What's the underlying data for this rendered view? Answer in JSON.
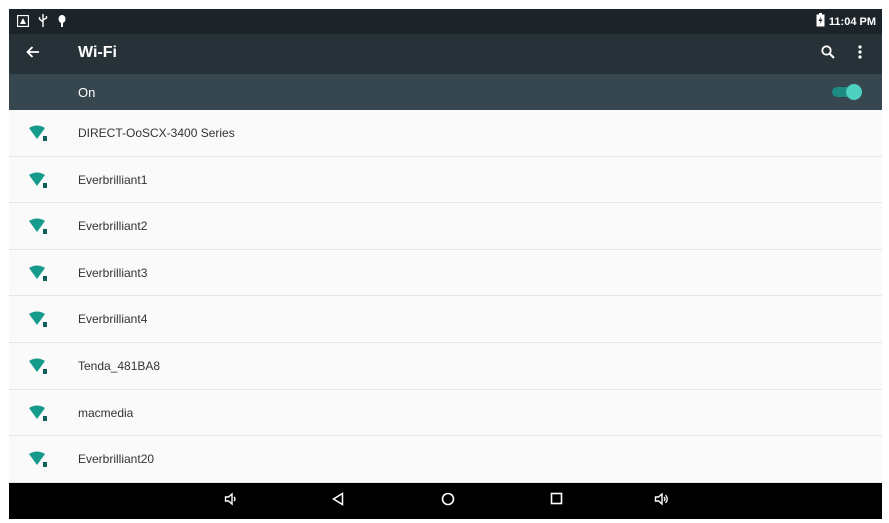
{
  "status_bar": {
    "time": "11:04 PM",
    "icons": [
      "notification-icon",
      "usb-icon",
      "debug-icon",
      "battery-icon"
    ]
  },
  "app_bar": {
    "title": "Wi-Fi",
    "icons": [
      "back-arrow-icon",
      "search-icon",
      "more-vert-icon"
    ]
  },
  "toggle": {
    "label": "On",
    "state": "on",
    "accent_color": "#4dd0c0"
  },
  "networks": [
    {
      "name": "DIRECT-OoSCX-3400 Series"
    },
    {
      "name": "Everbrilliant1"
    },
    {
      "name": "Everbrilliant2"
    },
    {
      "name": "Everbrilliant3"
    },
    {
      "name": "Everbrilliant4"
    },
    {
      "name": "Tenda_481BA8"
    },
    {
      "name": "macmedia"
    },
    {
      "name": "Everbrilliant20"
    }
  ],
  "nav_bar": {
    "icons": [
      "volume-down-icon",
      "back-icon",
      "home-icon",
      "recents-icon",
      "volume-up-icon"
    ]
  },
  "colors": {
    "status_bar": "#1c2329",
    "app_bar": "#263238",
    "toggle_bar": "#37474f",
    "wifi_icon": "#159a8c",
    "nav_bar": "#000000"
  }
}
